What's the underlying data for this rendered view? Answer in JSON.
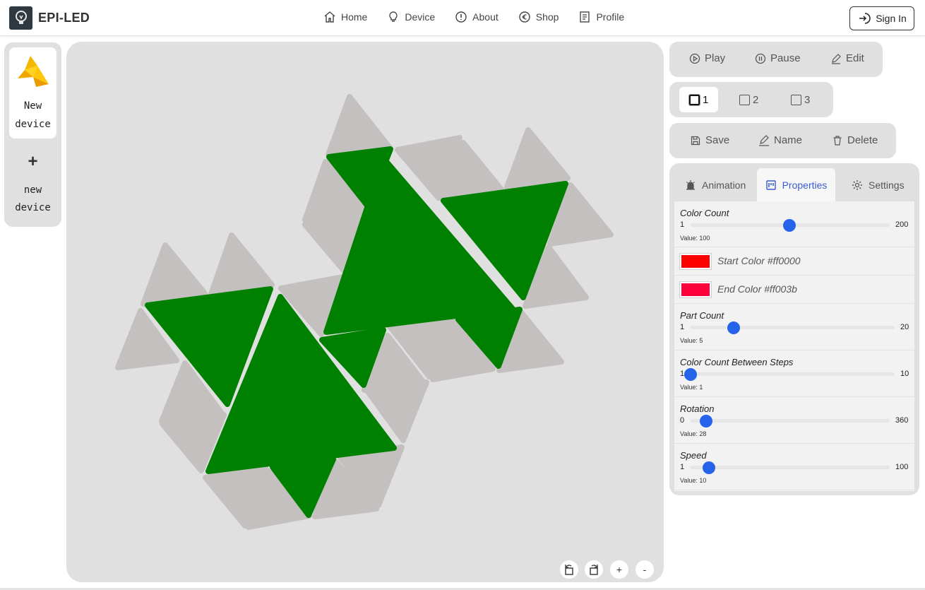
{
  "app": {
    "brand": "EPI-LED"
  },
  "nav": [
    {
      "label": "Home",
      "icon": "home-icon"
    },
    {
      "label": "Device",
      "icon": "bulb-icon"
    },
    {
      "label": "About",
      "icon": "info-icon"
    },
    {
      "label": "Shop",
      "icon": "euro-icon"
    },
    {
      "label": "Profile",
      "icon": "profile-icon"
    }
  ],
  "header": {
    "signin_label": "Sign In"
  },
  "sidebar": {
    "device_line1": "New",
    "device_line2": "device",
    "add_plus": "+",
    "add_line1": "new",
    "add_line2": "device"
  },
  "playback": {
    "play": "Play",
    "pause": "Pause",
    "edit": "Edit"
  },
  "slots": [
    "1",
    "2",
    "3"
  ],
  "actions": {
    "save": "Save",
    "name": "Name",
    "delete": "Delete"
  },
  "tabs": {
    "animation": "Animation",
    "properties": "Properties",
    "settings": "Settings",
    "active": "Properties"
  },
  "properties": {
    "color_count": {
      "label": "Color Count",
      "min": "1",
      "max": "200",
      "value_text": "Value: 100",
      "value": 100
    },
    "start_color": {
      "label": "Start Color #ff0000",
      "color": "#ff0000"
    },
    "end_color": {
      "label": "End Color #ff003b",
      "color": "#ff003b"
    },
    "part_count": {
      "label": "Part Count",
      "min": "1",
      "max": "20",
      "value_text": "Value: 5",
      "value": 5
    },
    "color_steps": {
      "label": "Color Count Between Steps",
      "min": "1",
      "max": "10",
      "value_text": "Value: 1",
      "value": 1
    },
    "rotation": {
      "label": "Rotation",
      "min": "0",
      "max": "360",
      "value_text": "Value: 28",
      "value": 28
    },
    "speed": {
      "label": "Speed",
      "min": "1",
      "max": "100",
      "value_text": "Value: 10",
      "value": 10
    }
  },
  "canvas_controls": {
    "zoom_in": "+",
    "zoom_out": "-"
  },
  "colors": {
    "active_led": "#008000",
    "inactive_led": "#c4c0bf",
    "canvas_bg": "#e0e0e0",
    "accent": "#2563eb"
  }
}
